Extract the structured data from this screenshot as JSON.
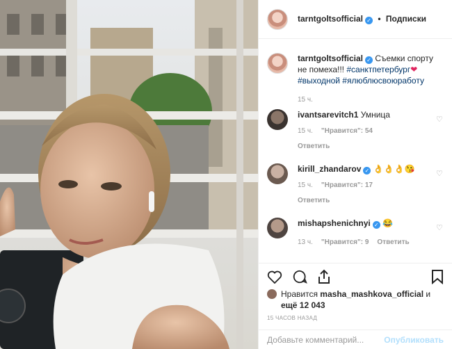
{
  "post": {
    "author": "tarntgoltsofficial",
    "follow_label": "Подписки",
    "separator": "•",
    "caption_text": "Съемки спорту не помеха!!!",
    "caption_tags": "#санктпетербург",
    "caption_heart": "❤",
    "caption_tags2": "#выходной #ялюблюсвоюработу",
    "caption_time": "15 ч."
  },
  "comments": [
    {
      "user": "ivantsarevitch1",
      "text": "Умница",
      "verified": false,
      "time": "15 ч.",
      "likes": "\"Нравится\": 54",
      "reply": "Ответить"
    },
    {
      "user": "kirill_zhandarov",
      "text": "👌👌👌😘",
      "verified": true,
      "time": "15 ч.",
      "likes": "\"Нравится\": 17",
      "reply": "Ответить"
    },
    {
      "user": "mishapshenichnyi",
      "text": "😂",
      "verified": true,
      "time": "13 ч.",
      "likes": "\"Нравится\": 9",
      "reply": "Ответить"
    }
  ],
  "likes": {
    "prefix": "Нравится",
    "user": "masha_mashkova_official",
    "suffix": "и",
    "more": "ещё 12 043"
  },
  "posted_ago": "15 ЧАСОВ НАЗАД",
  "add_comment": {
    "placeholder": "Добавьте комментарий...",
    "publish": "Опубликовать"
  },
  "colors": {
    "verified": "#3897f0",
    "link": "#003569",
    "muted": "#999999",
    "publish": "#b2dffc"
  }
}
